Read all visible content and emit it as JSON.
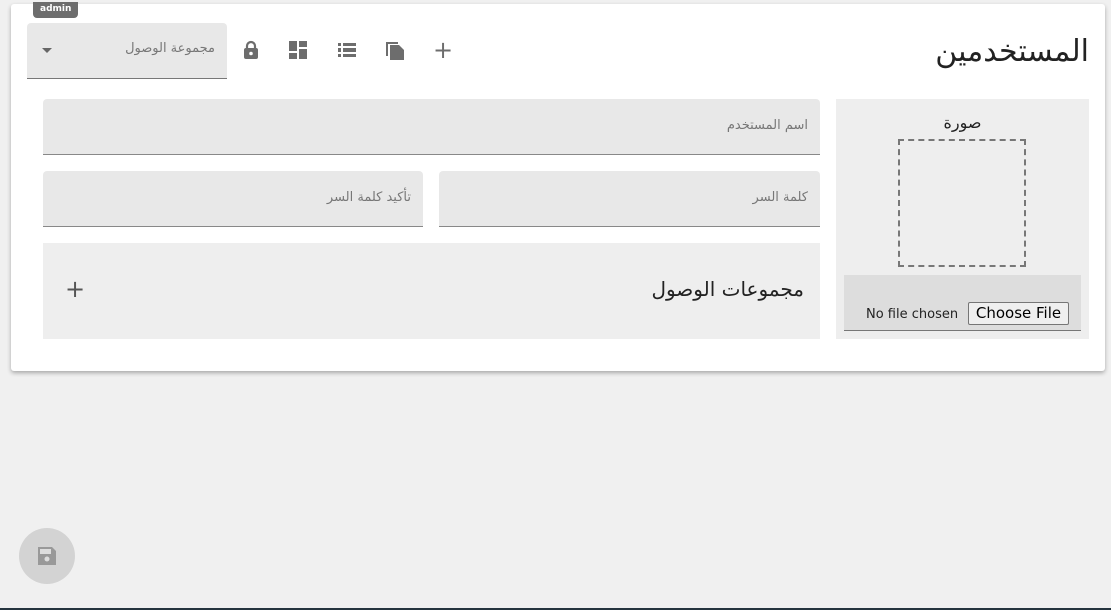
{
  "badge": "admin",
  "header": {
    "title": "المستخدمين",
    "access_group_select": "مجموعة الوصول"
  },
  "icons": [
    "lock-icon",
    "dashboard-icon",
    "list-icon",
    "copy-icon",
    "add-icon"
  ],
  "form": {
    "username_placeholder": "اسم المستخدم",
    "password_placeholder": "كلمة السر",
    "confirm_password_placeholder": "تأكيد كلمة السر",
    "access_groups_label": "مجموعات الوصول",
    "add_symbol": "+"
  },
  "photo": {
    "label": "صورة",
    "no_file": "No file chosen",
    "choose_file": "Choose File"
  }
}
